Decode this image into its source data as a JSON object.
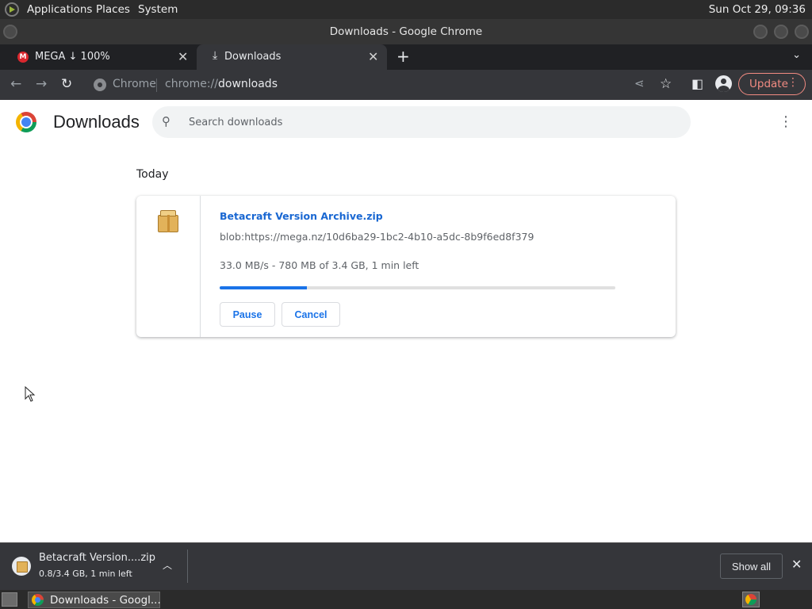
{
  "os_panel": {
    "menu": [
      "Applications",
      "Places",
      "System"
    ],
    "clock": "Sun Oct 29, 09:36"
  },
  "window": {
    "title": "Downloads - Google Chrome"
  },
  "tabs": [
    {
      "label": "MEGA ↓ 100%",
      "favicon": "M",
      "active": false
    },
    {
      "label": "Downloads",
      "active": true
    }
  ],
  "toolbar": {
    "chip_label": "Chrome",
    "url_prefix": "chrome://",
    "url_path": "downloads",
    "update_label": "Update"
  },
  "page": {
    "title": "Downloads",
    "search_placeholder": "Search downloads",
    "section": "Today"
  },
  "download": {
    "file_name": "Betacraft Version Archive.zip",
    "url": "blob:https://mega.nz/10d6ba29-1bc2-4b10-a5dc-8b9f6ed8f379",
    "status": "33.0 MB/s - 780 MB of 3.4 GB, 1 min left",
    "progress_fraction": 0.22,
    "pause_label": "Pause",
    "cancel_label": "Cancel"
  },
  "shelf": {
    "item_name": "Betacraft Version....zip",
    "item_status": "0.8/3.4 GB, 1 min left",
    "show_all_label": "Show all"
  },
  "taskbar": {
    "task_label": "Downloads - Googl..."
  },
  "colors": {
    "accent": "#1a73e8",
    "update": "#f28b82",
    "toolbar_bg": "#35363a"
  }
}
